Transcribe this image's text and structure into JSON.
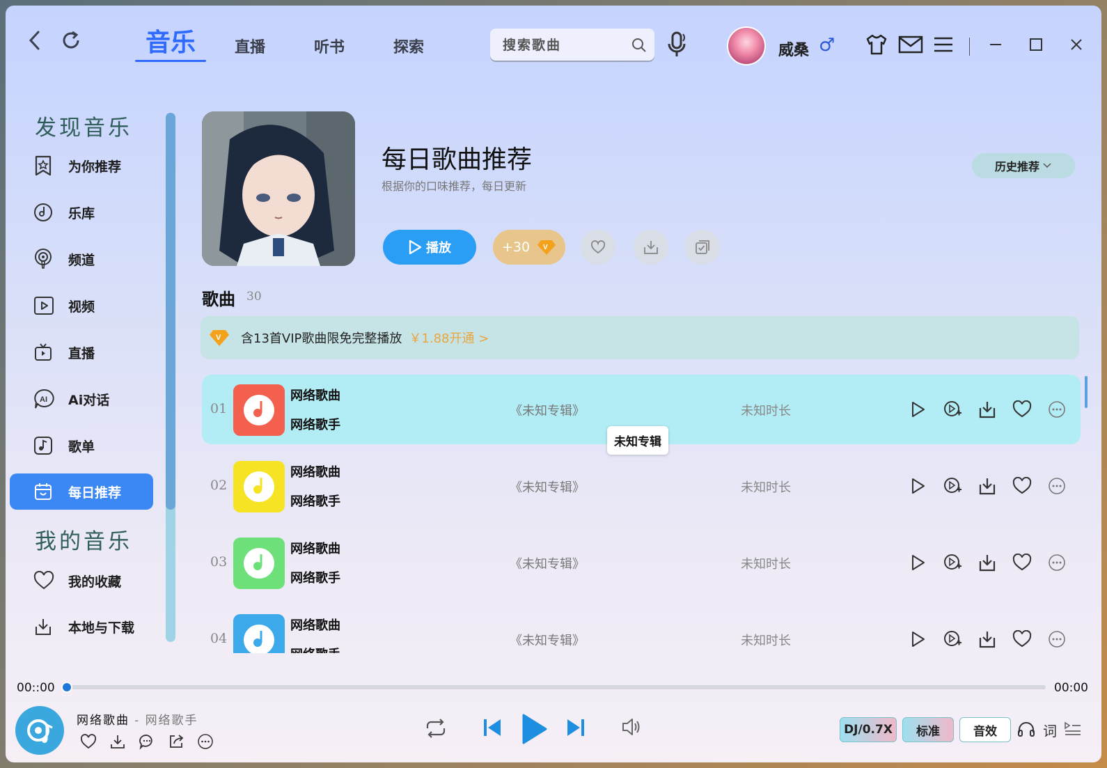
{
  "top_tabs": [
    {
      "label": "音乐",
      "active": true
    },
    {
      "label": "直播",
      "active": false
    },
    {
      "label": "听书",
      "active": false
    },
    {
      "label": "探索",
      "active": false
    }
  ],
  "search": {
    "placeholder": "搜索歌曲"
  },
  "user": {
    "name": "威桑",
    "gender": "♂"
  },
  "sidebar": {
    "discover_title": "发现音乐",
    "my_title": "我的音乐",
    "items": [
      {
        "label": "为你推荐",
        "icon": "star-bookmark-icon"
      },
      {
        "label": "乐库",
        "icon": "music-disc-icon"
      },
      {
        "label": "频道",
        "icon": "podcast-icon"
      },
      {
        "label": "视频",
        "icon": "video-icon"
      },
      {
        "label": "直播",
        "icon": "tv-icon"
      },
      {
        "label": "Ai对话",
        "icon": "ai-chat-icon"
      },
      {
        "label": "歌单",
        "icon": "playlist-icon"
      },
      {
        "label": "每日推荐",
        "icon": "calendar-icon",
        "active": true
      },
      {
        "label": "我的收藏",
        "icon": "heart-icon"
      },
      {
        "label": "本地与下载",
        "icon": "download-icon"
      }
    ]
  },
  "playlist": {
    "title": "每日歌曲推荐",
    "subtitle": "根据你的口味推荐，每日更新",
    "history_label": "历史推荐",
    "play_label": "播放",
    "vip_label": "+30"
  },
  "songs_section": {
    "label": "歌曲",
    "count": "30"
  },
  "vip_banner": {
    "text": "含13首VIP歌曲限免完整播放",
    "price": "￥1.88开通 >"
  },
  "songs": [
    {
      "index": "01",
      "name": "网络歌曲",
      "artist": "网络歌手",
      "album": "《未知专辑》",
      "duration": "未知时长",
      "color": "#f4604e"
    },
    {
      "index": "02",
      "name": "网络歌曲",
      "artist": "网络歌手",
      "album": "《未知专辑》",
      "duration": "未知时长",
      "color": "#f5e324"
    },
    {
      "index": "03",
      "name": "网络歌曲",
      "artist": "网络歌手",
      "album": "《未知专辑》",
      "duration": "未知时长",
      "color": "#6ee07a"
    },
    {
      "index": "04",
      "name": "网络歌曲",
      "artist": "网络歌手",
      "album": "《未知专辑》",
      "duration": "未知时长",
      "color": "#3ba9ea"
    }
  ],
  "tooltip": "未知专辑",
  "player": {
    "time_current": "00::00",
    "time_total": "00:00",
    "progress": 0,
    "song": "网络歌曲",
    "separator": " - ",
    "artist": "网络歌手",
    "dj_label": "DJ/0.7X",
    "quality_label": "标准",
    "effect_label": "音效",
    "lyric_label": "词"
  }
}
